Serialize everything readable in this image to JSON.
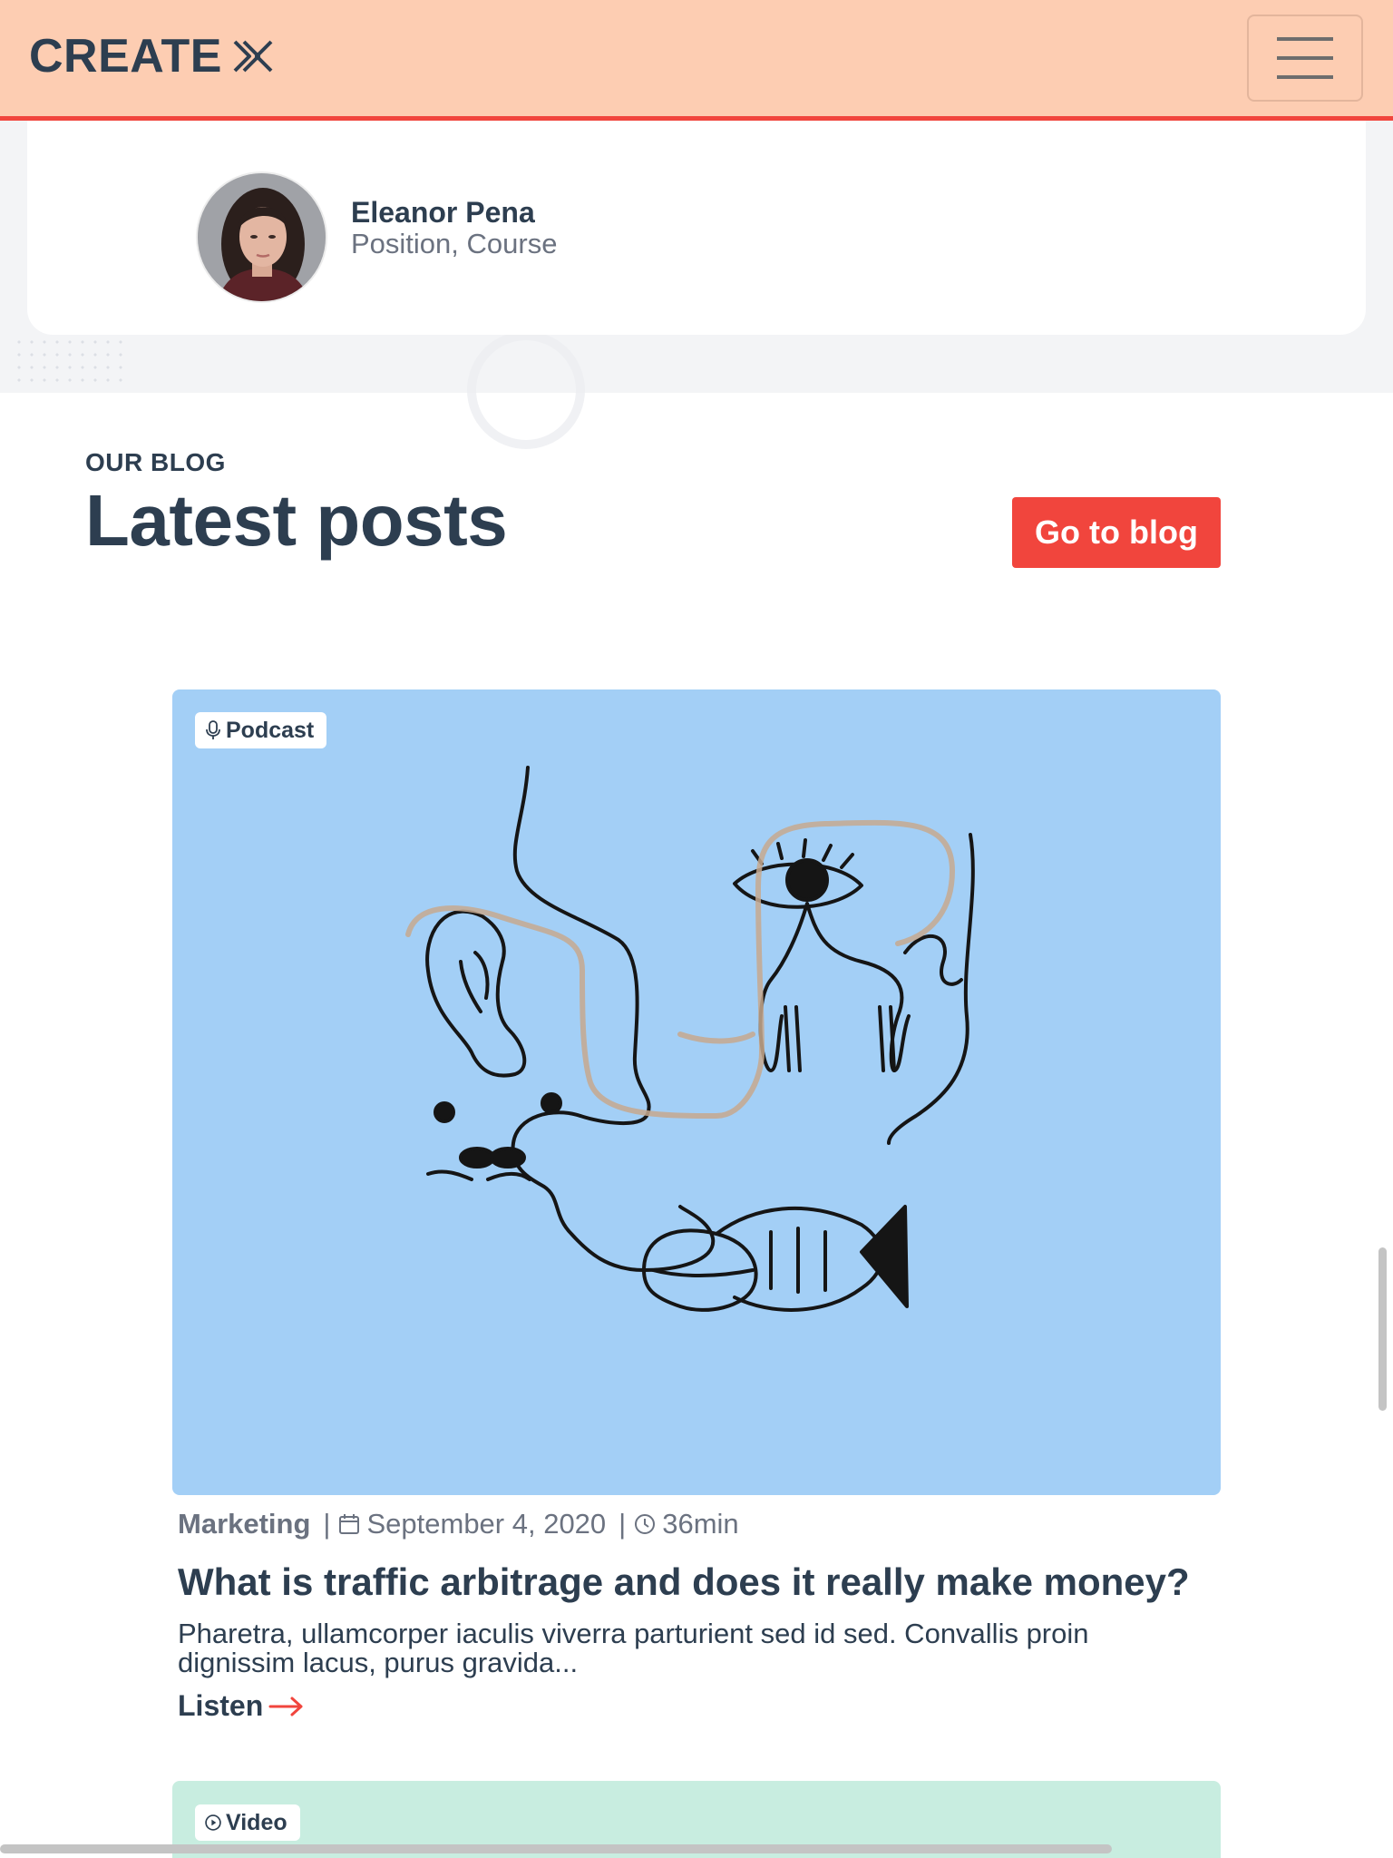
{
  "header": {
    "logo_text": "CREATE",
    "menu_icon": "hamburger-icon",
    "accent_border": "#f1453d",
    "background": "#fdcdb2"
  },
  "testimonial": {
    "author_name": "Eleanor Pena",
    "author_position": "Position, Course"
  },
  "blog": {
    "eyebrow": "OUR BLOG",
    "title": "Latest posts",
    "cta_label": "Go to blog",
    "cta_color": "#f1453d"
  },
  "posts": [
    {
      "tag": "Podcast",
      "tag_icon": "microphone-icon",
      "image_background": "#a3cff6",
      "category": "Marketing",
      "date": "September 4, 2020",
      "date_icon": "calendar-icon",
      "duration": "36min",
      "duration_icon": "clock-icon",
      "title": "What is traffic arbitrage and does it really make money?",
      "excerpt": "Pharetra, ullamcorper iaculis viverra parturient sed id sed. Convallis proin dignissim lacus, purus gravida...",
      "link_label": "Listen",
      "link_icon": "arrow-right-icon"
    },
    {
      "tag": "Video",
      "tag_icon": "play-circle-icon",
      "image_background": "#c8ede0"
    }
  ]
}
